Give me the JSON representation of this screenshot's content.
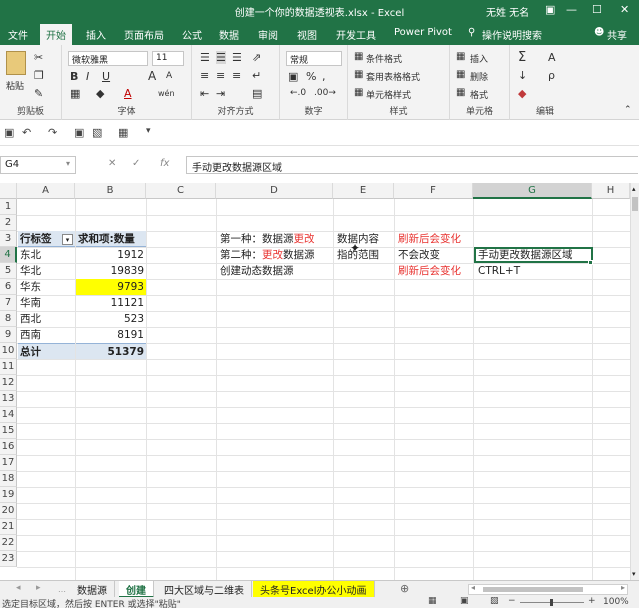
{
  "title_bar": {
    "title": "创建一个你的数据透视表.xlsx - Excel",
    "user": "无姓 无名",
    "ribbon_options_glyph": "▣",
    "minimize_glyph": "—",
    "restore_glyph": "☐",
    "close_glyph": "✕",
    "accent_color": "#217346"
  },
  "menu": {
    "items": [
      "文件",
      "开始",
      "插入",
      "页面布局",
      "公式",
      "数据",
      "审阅",
      "视图",
      "开发工具",
      "Power Pivot"
    ],
    "active_index": 1,
    "tell_me": "操作说明搜索",
    "share": "共享",
    "tell_me_icon": "lightbulb-icon",
    "share_icon": "person-icon"
  },
  "ribbon": {
    "clipboard": {
      "label": "剪贴板",
      "paste": "粘贴"
    },
    "font": {
      "label": "字体",
      "name": "微软雅黑",
      "size": "11",
      "bold": "B",
      "italic": "I",
      "underline": "U",
      "grow": "A",
      "shrink": "A",
      "font_color": "A",
      "wen": "wén"
    },
    "alignment": {
      "label": "对齐方式"
    },
    "number": {
      "label": "数字",
      "format": "常规",
      "percent": "%",
      "comma": ","
    },
    "styles": {
      "label": "样式",
      "conditional": "条件格式",
      "table": "套用表格格式",
      "cell": "单元格样式"
    },
    "cells": {
      "label": "单元格",
      "insert": "插入",
      "delete": "删除",
      "format": "格式"
    },
    "editing": {
      "label": "编辑",
      "sum": "Σ",
      "sort": "A",
      "find": "ρ",
      "clear": "◆"
    }
  },
  "formula_bar": {
    "name_box": "G4",
    "cancel": "✕",
    "enter": "✓",
    "fx": "fx",
    "content": "手动更改数据源区域"
  },
  "columns": [
    "A",
    "B",
    "C",
    "D",
    "E",
    "F",
    "G",
    "H"
  ],
  "selected_column": "G",
  "rows": [
    "1",
    "2",
    "3",
    "4",
    "5",
    "6",
    "7",
    "8",
    "9",
    "10",
    "11",
    "12",
    "13",
    "14",
    "15",
    "16",
    "17",
    "18",
    "19",
    "20",
    "21",
    "22",
    "23"
  ],
  "selected_row": "4",
  "pivot": {
    "row_label_header": "行标签",
    "value_header": "求和项:数量",
    "rows": [
      {
        "label": "东北",
        "value": "1912"
      },
      {
        "label": "华北",
        "value": "19839"
      },
      {
        "label": "华东",
        "value": "9793"
      },
      {
        "label": "华南",
        "value": "11121"
      },
      {
        "label": "西北",
        "value": "523"
      },
      {
        "label": "西南",
        "value": "8191"
      }
    ],
    "total_label": "总计",
    "total_value": "51379",
    "header_bg": "#dce6f1",
    "highlight_bg": "#ffff00"
  },
  "notes": {
    "r3_d_prefix": "第一种：数据源",
    "r3_d_red": "更改",
    "r3_e": "数据内容",
    "r3_f": "刷新后会变化",
    "r4_d_prefix": "第二种：",
    "r4_d_red": "更改",
    "r4_d_suffix": "数据源",
    "r4_e": "指的范围",
    "r4_f": "不会改变",
    "r4_g": "手动更改数据源区域",
    "r5_d": "创建动态数据源",
    "r5_f": "刷新后会变化",
    "r5_g": "CTRL+T",
    "red_color": "#e8322f"
  },
  "sheet_tabs": {
    "nav_prev": "◂",
    "nav_next": "▸",
    "tabs": [
      "数据源",
      "创建",
      "四大区域与二维表",
      "头条号Excel办公小动画"
    ],
    "active_index": 1,
    "add": "⊕",
    "hscroll_left": "◂",
    "hscroll_right": "▸",
    "highlight_tab_color": "#ffff00"
  },
  "status_bar": {
    "message": "选定目标区域，然后按 ENTER 或选择\"粘贴\"",
    "zoom": "100%",
    "zoom_minus": "−",
    "zoom_plus": "+"
  }
}
